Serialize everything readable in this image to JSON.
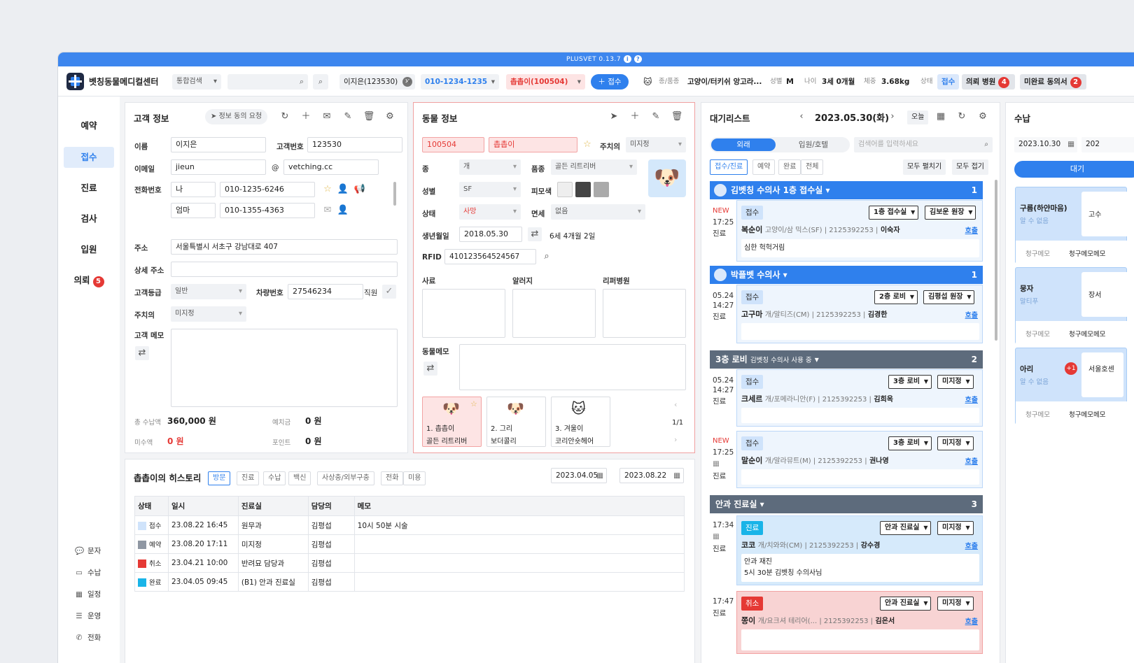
{
  "app": {
    "version": "PLUSVET 0.13.7",
    "clinic": "벳칭동물메디컬센터"
  },
  "toolbar": {
    "search_scope": "통합검색",
    "client": "이지은(123530)",
    "phone": "010-1234-1235",
    "pet": "촙촙이(100504)",
    "add_reception": "접수",
    "species_label": "종/품종",
    "species": "고양이/터키쉬 앙고라...",
    "sex_label": "성별",
    "sex": "M",
    "age_label": "나이",
    "age": "3세 0개월",
    "weight_label": "체중",
    "weight": "3.68kg",
    "status_label": "상태",
    "status": "접수",
    "referral_label": "의뢰 병원",
    "referral_count": "4",
    "consent_label": "미완료 동의서",
    "consent_count": "2"
  },
  "nav": {
    "items": [
      "예약",
      "접수",
      "진료",
      "검사",
      "입원",
      "의뢰"
    ],
    "referral_badge": "5",
    "bottom": [
      "문자",
      "수납",
      "일정",
      "운영",
      "전화"
    ]
  },
  "customer": {
    "title": "고객 정보",
    "consent_btn": "정보 동의 요청",
    "name_label": "이름",
    "name": "이지은",
    "cust_no_label": "고객번호",
    "cust_no": "123530",
    "email_label": "이메일",
    "email_id": "jieun",
    "at": "@",
    "email_domain": "vetching.cc",
    "phone_label": "전화번호",
    "phone1_rel": "나",
    "phone1": "010-1235-6246",
    "phone2_rel": "엄마",
    "phone2": "010-1355-4363",
    "addr_label": "주소",
    "addr": "서울특별시 서초구 강남대로 407",
    "addr2_label": "상세 주소",
    "addr2": "",
    "grade_label": "고객등급",
    "grade": "일반",
    "car_label": "차량번호",
    "car": "27546234",
    "staff_label": "직원",
    "vet_label": "주치의",
    "vet": "미지정",
    "memo_label": "고객 메모",
    "paid_label": "총 수납액",
    "paid": "360,000 원",
    "deposit_label": "예치금",
    "deposit": "0 원",
    "unpaid_label": "미수액",
    "unpaid": "0 원",
    "point_label": "포인트",
    "point": "0 원"
  },
  "animal": {
    "title": "동물 정보",
    "id": "100504",
    "name": "촙촙이",
    "vet_label": "주치의",
    "vet": "미지정",
    "species_label": "종",
    "species": "개",
    "breed_label": "품종",
    "breed": "골든 리트리버",
    "sex_label": "성별",
    "sex": "SF",
    "coat_label": "피모색",
    "state_label": "상태",
    "state": "사망",
    "immune_label": "면세",
    "immune": "없음",
    "birth_label": "생년월일",
    "birth": "2018.05.30",
    "age": "6세 4개월 2일",
    "rfid_label": "RFID",
    "rfid": "410123564524567",
    "feed_label": "사료",
    "allergy_label": "알러지",
    "referrer_label": "리퍼병원",
    "memo_label": "동물메모",
    "pets": [
      {
        "name": "1. 촙촙이",
        "breed": "골든 리트리버"
      },
      {
        "name": "2. 그리",
        "breed": "보더콜리"
      },
      {
        "name": "3. 겨울이",
        "breed": "코리안숏헤어"
      }
    ],
    "page": "1/1",
    "colors": [
      "#eeeeee",
      "#444444",
      "#aaaaaa"
    ]
  },
  "history": {
    "title": "촙촙이의 히스토리",
    "tabs": [
      "방문",
      "진료",
      "수납",
      "백신",
      "사상충/외부구충",
      "전화",
      "미용"
    ],
    "from": "2023.04.05",
    "to": "2023.08.22",
    "cols": [
      "상태",
      "일시",
      "진료실",
      "담당의",
      "메모"
    ],
    "rows": [
      {
        "state": "접수",
        "color": "#cfe3fb",
        "time": "23.08.22 16:45",
        "room": "원무과",
        "doc": "김평섭",
        "memo": "10시 50분 시술"
      },
      {
        "state": "예약",
        "color": "#8f97a3",
        "time": "23.08.20 17:11",
        "room": "미지정",
        "doc": "김평섭",
        "memo": ""
      },
      {
        "state": "취소",
        "color": "#e53935",
        "time": "23.04.21 10:00",
        "room": "반려묘 담당과",
        "doc": "김평섭",
        "memo": ""
      },
      {
        "state": "완료",
        "color": "#19b4e8",
        "time": "23.04.05 09:45",
        "room": "(B1) 안과 진료실",
        "doc": "김평섭",
        "memo": ""
      }
    ]
  },
  "waitlist": {
    "title": "대기리스트",
    "date": "2023.05.30(화)",
    "today": "오늘",
    "tab_out": "외래",
    "tab_in": "입원/호텔",
    "search_placeholder": "검색어를 입력하세요",
    "filters": [
      "접수/진료",
      "예약",
      "완료",
      "전체"
    ],
    "expand": "모두 펼치기",
    "collapse": "모두 접기",
    "groups": [
      {
        "title": "김벳칭 수의사 1층 접수실",
        "count": "1"
      },
      {
        "title": "박플벳 수의사",
        "count": "1"
      },
      {
        "title": "3층 로비",
        "sub": "김벳칭 수의사 사용 중",
        "count": "2"
      },
      {
        "title": "안과 진료실",
        "count": "3"
      }
    ],
    "cards": [
      {
        "time1": "NEW",
        "time2": "17:25",
        "state": "진료",
        "tag": "접수",
        "room": "1층 접수실",
        "doc": "김보운 원장",
        "name": "복순이",
        "info": "고양이/삼 믹스(SF) | 2125392253 |",
        "owner": "이숙자",
        "memo": "심한 헉헉거림",
        "call": "호출"
      },
      {
        "time1": "05.24",
        "time2": "14:27",
        "state": "진료",
        "tag": "접수",
        "room": "2층 로비",
        "doc": "김평섭 원장",
        "name": "고구마",
        "info": "개/말티즈(CM) | 2125392253 |",
        "owner": "김경한",
        "memo": "",
        "call": "호출"
      },
      {
        "time1": "05.24",
        "time2": "14:27",
        "state": "진료",
        "tag": "접수",
        "room": "3층 로비",
        "doc": "미지정",
        "name": "크세르",
        "info": "개/포메라니안(F) | 2125392253 |",
        "owner": "김희옥",
        "memo": "",
        "call": "호출"
      },
      {
        "time1": "NEW",
        "time2": "17:25",
        "state": "진료",
        "tag": "접수",
        "room": "3층 로비",
        "doc": "미지정",
        "name": "말순이",
        "info": "개/말라뮤트(M) | 2125392253 |",
        "owner": "권나영",
        "memo": "",
        "call": "호출"
      },
      {
        "time1": "17:34",
        "time2": "",
        "state": "진료",
        "tag": "진료",
        "room": "안과 진료실",
        "doc": "미지정",
        "name": "코코",
        "info": "개/치와와(CM) | 2125392253 |",
        "owner": "강수경",
        "memo": "안과 재진",
        "memo2": "5시 30분 김벳칭 수의사님",
        "call": "호출"
      },
      {
        "time1": "17:47",
        "time2": "",
        "state": "진료",
        "tag": "취소",
        "room": "안과 진료실",
        "doc": "미지정",
        "name": "쫑이",
        "info": "개/요크셔 테리어(... | 2125392253 |",
        "owner": "김은서",
        "memo": "",
        "call": "호출"
      }
    ]
  },
  "payment": {
    "title": "수납",
    "date": "2023.10.30",
    "date2": "202",
    "tab": "대기",
    "cards": [
      {
        "name": "구름(하얀마음)",
        "sub": "알 수 없음",
        "side": "고수",
        "memo": "청구메모",
        "memo2": "청구메모메모"
      },
      {
        "name": "뭉자",
        "sub": "말티푸",
        "side": "장서",
        "memo": "청구메모",
        "memo2": "청구메모메모"
      },
      {
        "name": "아리",
        "sub": "알 수 없음",
        "side": "서울호센",
        "badge": "+1",
        "memo": "청구메모",
        "memo2": "청구메모메모"
      }
    ]
  }
}
